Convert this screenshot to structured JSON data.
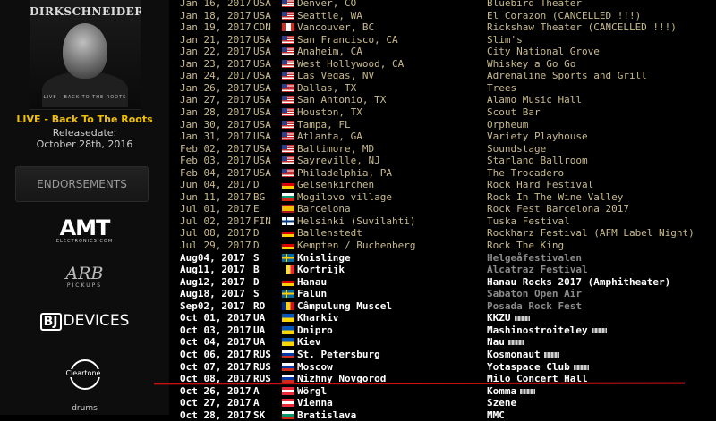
{
  "sidebar": {
    "album": {
      "cover_band": "DIRKSCHNEIDER",
      "cover_subtitle": "LIVE - BACK TO THE ROOTS",
      "title": "LIVE - Back To The Roots",
      "release_label": "Releasedate:",
      "release_date": "October 28th, 2016"
    },
    "endorsements_label": "ENDORSEMENTS",
    "logos": {
      "amt": {
        "main": "AMT",
        "sub": "ELECTRONICS.COM"
      },
      "arb": {
        "main": "ARB",
        "sub": "PICKUPS"
      },
      "bj": {
        "box": "BJ",
        "main": "DEVICES"
      },
      "cleartone": {
        "main": "Cleartone"
      },
      "drums": {
        "main": "drums"
      }
    }
  },
  "colors": {
    "background": "#000000",
    "normal_text": "#c8ba8a",
    "highlight_text": "#ffffff",
    "faded_venue": "#8a8a8a",
    "album_title": "#f0c000",
    "divider_line": "#c81010"
  },
  "tour": [
    {
      "date": "Jan 16, 2017",
      "country": "USA",
      "flag": "usa",
      "city": "Denver, CO",
      "venue": "Bluebird Theater",
      "style": "normal"
    },
    {
      "date": "Jan 18, 2017",
      "country": "USA",
      "flag": "usa",
      "city": "Seattle, WA",
      "venue": "El Corazon (CANCELLED !!!)",
      "style": "normal"
    },
    {
      "date": "Jan 19, 2017",
      "country": "CDN",
      "flag": "cdn",
      "city": "Vancouver, BC",
      "venue": "Rickshaw Theater (CANCELLED !!!)",
      "style": "normal"
    },
    {
      "date": "Jan 21, 2017",
      "country": "USA",
      "flag": "usa",
      "city": "San Francisco, CA",
      "venue": "Slim's",
      "style": "normal"
    },
    {
      "date": "Jan 22, 2017",
      "country": "USA",
      "flag": "usa",
      "city": "Anaheim, CA",
      "venue": "City National Grove",
      "style": "normal"
    },
    {
      "date": "Jan 23, 2017",
      "country": "USA",
      "flag": "usa",
      "city": "West Hollywood, CA",
      "venue": "Whiskey a Go Go",
      "style": "normal"
    },
    {
      "date": "Jan 24, 2017",
      "country": "USA",
      "flag": "usa",
      "city": "Las Vegas, NV",
      "venue": "Adrenaline Sports and Grill",
      "style": "normal"
    },
    {
      "date": "Jan 26, 2017",
      "country": "USA",
      "flag": "usa",
      "city": "Dallas, TX",
      "venue": "Trees",
      "style": "normal"
    },
    {
      "date": "Jan 27, 2017",
      "country": "USA",
      "flag": "usa",
      "city": "San Antonio, TX",
      "venue": "Alamo Music Hall",
      "style": "normal"
    },
    {
      "date": "Jan 28, 2017",
      "country": "USA",
      "flag": "usa",
      "city": "Houston, TX",
      "venue": "Scout Bar",
      "style": "normal"
    },
    {
      "date": "Jan 30, 2017",
      "country": "USA",
      "flag": "usa",
      "city": "Tampa, FL",
      "venue": "Orpheum",
      "style": "normal"
    },
    {
      "date": "Jan 31, 2017",
      "country": "USA",
      "flag": "usa",
      "city": "Atlanta, GA",
      "venue": "Variety Playhouse",
      "style": "normal"
    },
    {
      "date": "Feb 02, 2017",
      "country": "USA",
      "flag": "usa",
      "city": "Baltimore, MD",
      "venue": "Soundstage",
      "style": "normal"
    },
    {
      "date": "Feb 03, 2017",
      "country": "USA",
      "flag": "usa",
      "city": "Sayreville, NJ",
      "venue": "Starland Ballroom",
      "style": "normal"
    },
    {
      "date": "Feb 04, 2017",
      "country": "USA",
      "flag": "usa",
      "city": "Philadelphia, PA",
      "venue": "The Trocadero",
      "style": "normal"
    },
    {
      "date": "Jun 04, 2017",
      "country": "D",
      "flag": "d",
      "city": "Gelsenkirchen",
      "venue": "Rock Hard Festival",
      "style": "normal"
    },
    {
      "date": "Jun 11, 2017",
      "country": "BG",
      "flag": "bg",
      "city": "Mogilovo village",
      "venue": "Rock In The Wine Valley",
      "style": "normal"
    },
    {
      "date": "Jul 01, 2017",
      "country": "E",
      "flag": "e",
      "city": "Barcelona",
      "venue": "Rock Fest Barcelona 2017",
      "style": "normal"
    },
    {
      "date": "Jul 02, 2017",
      "country": "FIN",
      "flag": "fin",
      "city": "Helsinki (Suvilahti)",
      "venue": "Tuska Festival",
      "style": "normal"
    },
    {
      "date": "Jul 08, 2017",
      "country": "D",
      "flag": "d",
      "city": "Ballenstedt",
      "venue": "Rockharz Festival (AFM Label Night)",
      "style": "normal"
    },
    {
      "date": "Jul 29, 2017",
      "country": "D",
      "flag": "d",
      "city": "Kempten / Buchenberg",
      "venue": "Rock The King",
      "style": "normal"
    },
    {
      "date": "Aug04, 2017",
      "country": "S",
      "flag": "s",
      "city": "Knislinge",
      "venue": "Helgeåfestivalen",
      "style": "bold",
      "faded": true
    },
    {
      "date": "Aug11, 2017",
      "country": "B",
      "flag": "b",
      "city": "Kortrijk",
      "venue": "Alcatraz Festival",
      "style": "bold",
      "faded": true
    },
    {
      "date": "Aug12, 2017",
      "country": "D",
      "flag": "d",
      "city": "Hanau",
      "venue": "Hanau Rocks 2017 (Amphitheater)",
      "style": "bold"
    },
    {
      "date": "Aug18, 2017",
      "country": "S",
      "flag": "s",
      "city": "Falun",
      "venue": "Sabaton Open Air",
      "style": "bold",
      "faded": true
    },
    {
      "date": "Sep02, 2017",
      "country": "RO",
      "flag": "ro",
      "city": "Câmpulung Muscel",
      "venue": "Posada Rock Fest",
      "style": "bold",
      "faded": true
    },
    {
      "date": "Oct 01, 2017",
      "country": "UA",
      "flag": "ua",
      "city": "Kharkiv",
      "venue": "KKZU",
      "style": "bold",
      "censor": true
    },
    {
      "date": "Oct 03, 2017",
      "country": "UA",
      "flag": "ua",
      "city": "Dnipro",
      "venue": "Mashinostroiteley",
      "style": "bold",
      "censor": true
    },
    {
      "date": "Oct 04, 2017",
      "country": "UA",
      "flag": "ua",
      "city": "Kiev",
      "venue": "Nau",
      "style": "bold",
      "censor": true
    },
    {
      "date": "Oct 06, 2017",
      "country": "RUS",
      "flag": "rus",
      "city": "St. Petersburg",
      "venue": "Kosmonaut",
      "style": "bold",
      "censor": true
    },
    {
      "date": "Oct 07, 2017",
      "country": "RUS",
      "flag": "rus",
      "city": "Moscow",
      "venue": "Yotaspace Club",
      "style": "bold",
      "censor": true
    },
    {
      "date": "Oct 08, 2017",
      "country": "RUS",
      "flag": "rus",
      "city": "Nizhny Novgorod",
      "venue": "Milo Concert Hall",
      "style": "bold"
    },
    {
      "date": "Oct 26, 2017",
      "country": "A",
      "flag": "a",
      "city": "Wörgl",
      "venue": "Komma",
      "style": "bold",
      "censor": true
    },
    {
      "date": "Oct 27, 2017",
      "country": "A",
      "flag": "a",
      "city": "Vienna",
      "venue": "Szene",
      "style": "bold"
    },
    {
      "date": "Oct 28, 2017",
      "country": "SK",
      "flag": "bk",
      "city": "Bratislava",
      "venue": "MMC",
      "style": "bold"
    }
  ]
}
